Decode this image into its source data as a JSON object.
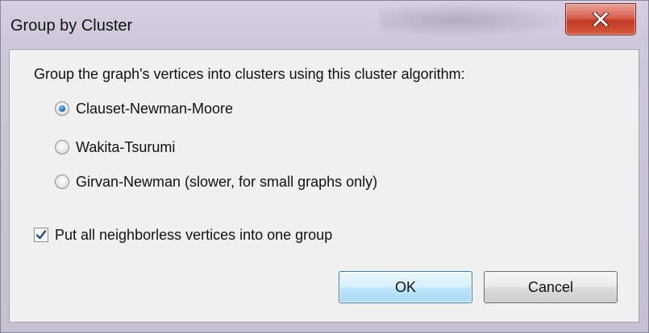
{
  "window": {
    "title": "Group by Cluster"
  },
  "dialog": {
    "prompt": "Group the graph's vertices into clusters using this cluster algorithm:",
    "algorithms": [
      {
        "label": "Clauset-Newman-Moore",
        "selected": true
      },
      {
        "label": "Wakita-Tsurumi",
        "selected": false
      },
      {
        "label": "Girvan-Newman (slower, for small graphs only)",
        "selected": false
      }
    ],
    "neighborless_option": {
      "label": "Put all neighborless vertices into one group",
      "checked": true
    },
    "ok_label": "OK",
    "cancel_label": "Cancel"
  },
  "icons": {
    "close": "close-icon",
    "radio_selected": "radio-selected-icon",
    "radio_unselected": "radio-unselected-icon",
    "checkmark": "checkmark-icon"
  },
  "colors": {
    "close_button": "#c23a26",
    "default_button_border": "#3c7fb1",
    "radio_dot": "#1f6fb8",
    "checkmark": "#2b4a8a"
  }
}
